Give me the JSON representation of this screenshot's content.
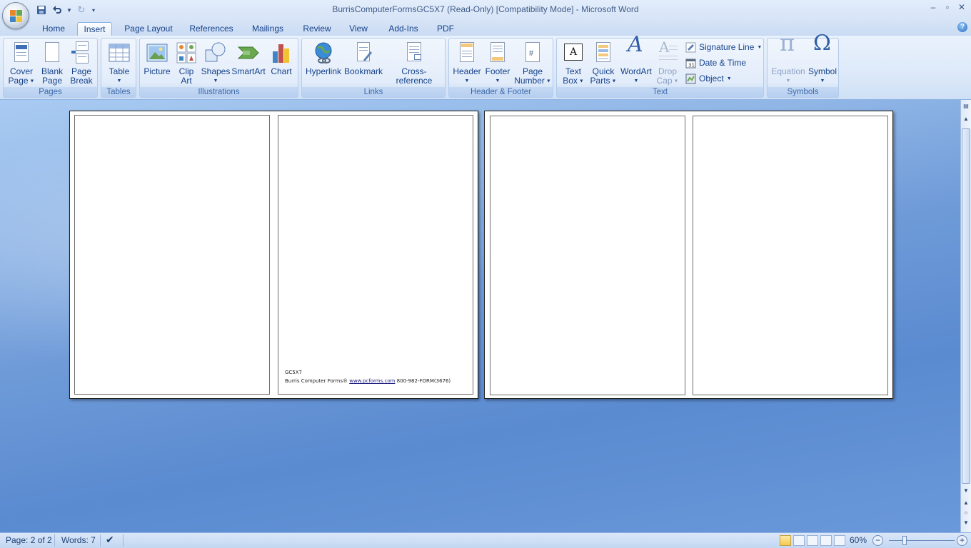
{
  "window": {
    "title": "BurrisComputerFormsGC5X7 (Read-Only) [Compatibility Mode] - Microsoft Word",
    "controls": [
      "–",
      "▫",
      "✕"
    ]
  },
  "qat": {
    "save": "save-icon",
    "undo": "undo-icon",
    "redo": "redo-icon",
    "customize": "customize-icon"
  },
  "tabs": [
    {
      "label": "Home"
    },
    {
      "label": "Insert",
      "active": true
    },
    {
      "label": "Page Layout"
    },
    {
      "label": "References"
    },
    {
      "label": "Mailings"
    },
    {
      "label": "Review"
    },
    {
      "label": "View"
    },
    {
      "label": "Add-Ins"
    },
    {
      "label": "PDF"
    }
  ],
  "ribbon": {
    "pages": {
      "label": "Pages",
      "cover": [
        "Cover",
        "Page"
      ],
      "blank": [
        "Blank",
        "Page"
      ],
      "break": [
        "Page",
        "Break"
      ]
    },
    "tables": {
      "label": "Tables",
      "table": "Table"
    },
    "illustrations": {
      "label": "Illustrations",
      "picture": "Picture",
      "clipart": [
        "Clip",
        "Art"
      ],
      "shapes": "Shapes",
      "smartart": "SmartArt",
      "chart": "Chart"
    },
    "links": {
      "label": "Links",
      "hyperlink": "Hyperlink",
      "bookmark": "Bookmark",
      "crossref": "Cross-reference"
    },
    "headerfooter": {
      "label": "Header & Footer",
      "header": "Header",
      "footer": "Footer",
      "pagenumber": [
        "Page",
        "Number"
      ]
    },
    "text": {
      "label": "Text",
      "textbox": [
        "Text",
        "Box"
      ],
      "quickparts": [
        "Quick",
        "Parts"
      ],
      "wordart": "WordArt",
      "dropcap": [
        "Drop",
        "Cap"
      ],
      "signature": "Signature Line",
      "datetime": "Date & Time",
      "object": "Object"
    },
    "symbols": {
      "label": "Symbols",
      "equation": "Equation",
      "symbol": "Symbol"
    }
  },
  "document": {
    "footer_code": "GC5X7",
    "footer_brand": "Burris Computer Forms®",
    "footer_url": "www.pcforms.com",
    "footer_phone": "800-982-FORM(3676)"
  },
  "status": {
    "page": "Page: 2 of 2",
    "words": "Words: 7",
    "zoom": "60%",
    "zoom_level": 0.6
  },
  "colors": {
    "ribbon_text": "#15428b",
    "background": "#4d7fc4"
  }
}
